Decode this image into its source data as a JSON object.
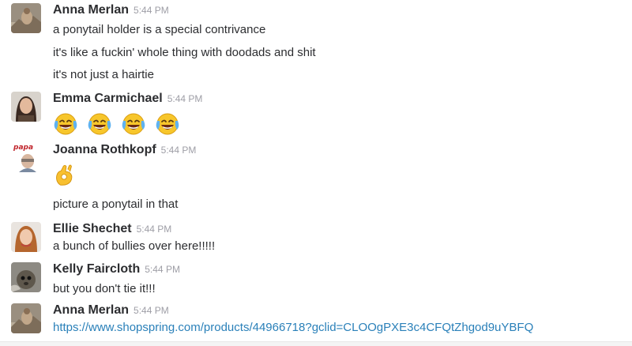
{
  "messages": [
    {
      "author": "Anna Merlan",
      "time": "5:44 PM",
      "avatar": "anna-avatar",
      "lines": [
        "a ponytail holder is a special contrivance",
        "it's like a fuckin' whole thing with doodads and shit",
        "it's not just a hairtie"
      ]
    },
    {
      "author": "Emma Carmichael",
      "time": "5:44 PM",
      "avatar": "emma-avatar",
      "emoji": [
        "face-with-tears-of-joy",
        "face-with-tears-of-joy",
        "face-with-tears-of-joy",
        "face-with-tears-of-joy"
      ]
    },
    {
      "author": "Joanna Rothkopf",
      "time": "5:44 PM",
      "avatar": "joanna-avatar",
      "avatar_text": "papa",
      "emoji": [
        "ok-hand"
      ],
      "lines": [
        "picture a ponytail in that"
      ]
    },
    {
      "author": "Ellie Shechet",
      "time": "5:44 PM",
      "avatar": "ellie-avatar",
      "lines": [
        "a bunch of bullies over here!!!!!"
      ]
    },
    {
      "author": "Kelly Faircloth",
      "time": "5:44 PM",
      "avatar": "kelly-avatar",
      "lines": [
        "but you don't tie it!!!"
      ]
    },
    {
      "author": "Anna Merlan",
      "time": "5:44 PM",
      "avatar": "anna-avatar",
      "link": "https://www.shopspring.com/products/44966718?gclid=CLOOgPXE3c4CFQtZhgod9uYBFQ"
    }
  ],
  "colors": {
    "author": "#2c2d30",
    "timestamp": "#9e9ea6",
    "link": "#2a80b9"
  }
}
